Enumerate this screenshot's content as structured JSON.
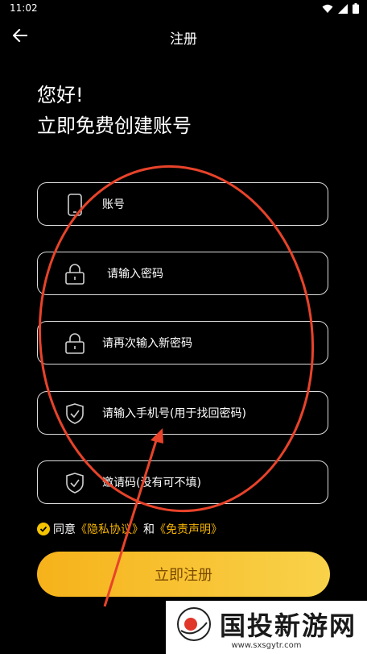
{
  "status_bar": {
    "time": "11:02"
  },
  "app_bar": {
    "title": "注册"
  },
  "greeting": {
    "line1": "您好!",
    "line2": "立即免费创建账号"
  },
  "fields": [
    {
      "placeholder": "账号",
      "icon": "phone-icon"
    },
    {
      "placeholder": "请输入密码",
      "icon": "lock-icon"
    },
    {
      "placeholder": "请再次输入新密码",
      "icon": "lock-icon"
    },
    {
      "placeholder": "请输入手机号(用于找回密码)",
      "icon": "shield-check-icon"
    },
    {
      "placeholder": "邀请码(没有可不填)",
      "icon": "shield-check-icon"
    }
  ],
  "agreement": {
    "prefix": "同意",
    "privacy_link": "《隐私协议》",
    "and": "和",
    "disclaimer_link": "《免责声明》"
  },
  "register_button": {
    "label": "立即注册"
  },
  "watermark": {
    "title": "国投新游网",
    "url": "www.sxsgytr.com"
  },
  "colors": {
    "accent": "#f5c400",
    "annotation": "#e8432a",
    "background": "#000000"
  }
}
